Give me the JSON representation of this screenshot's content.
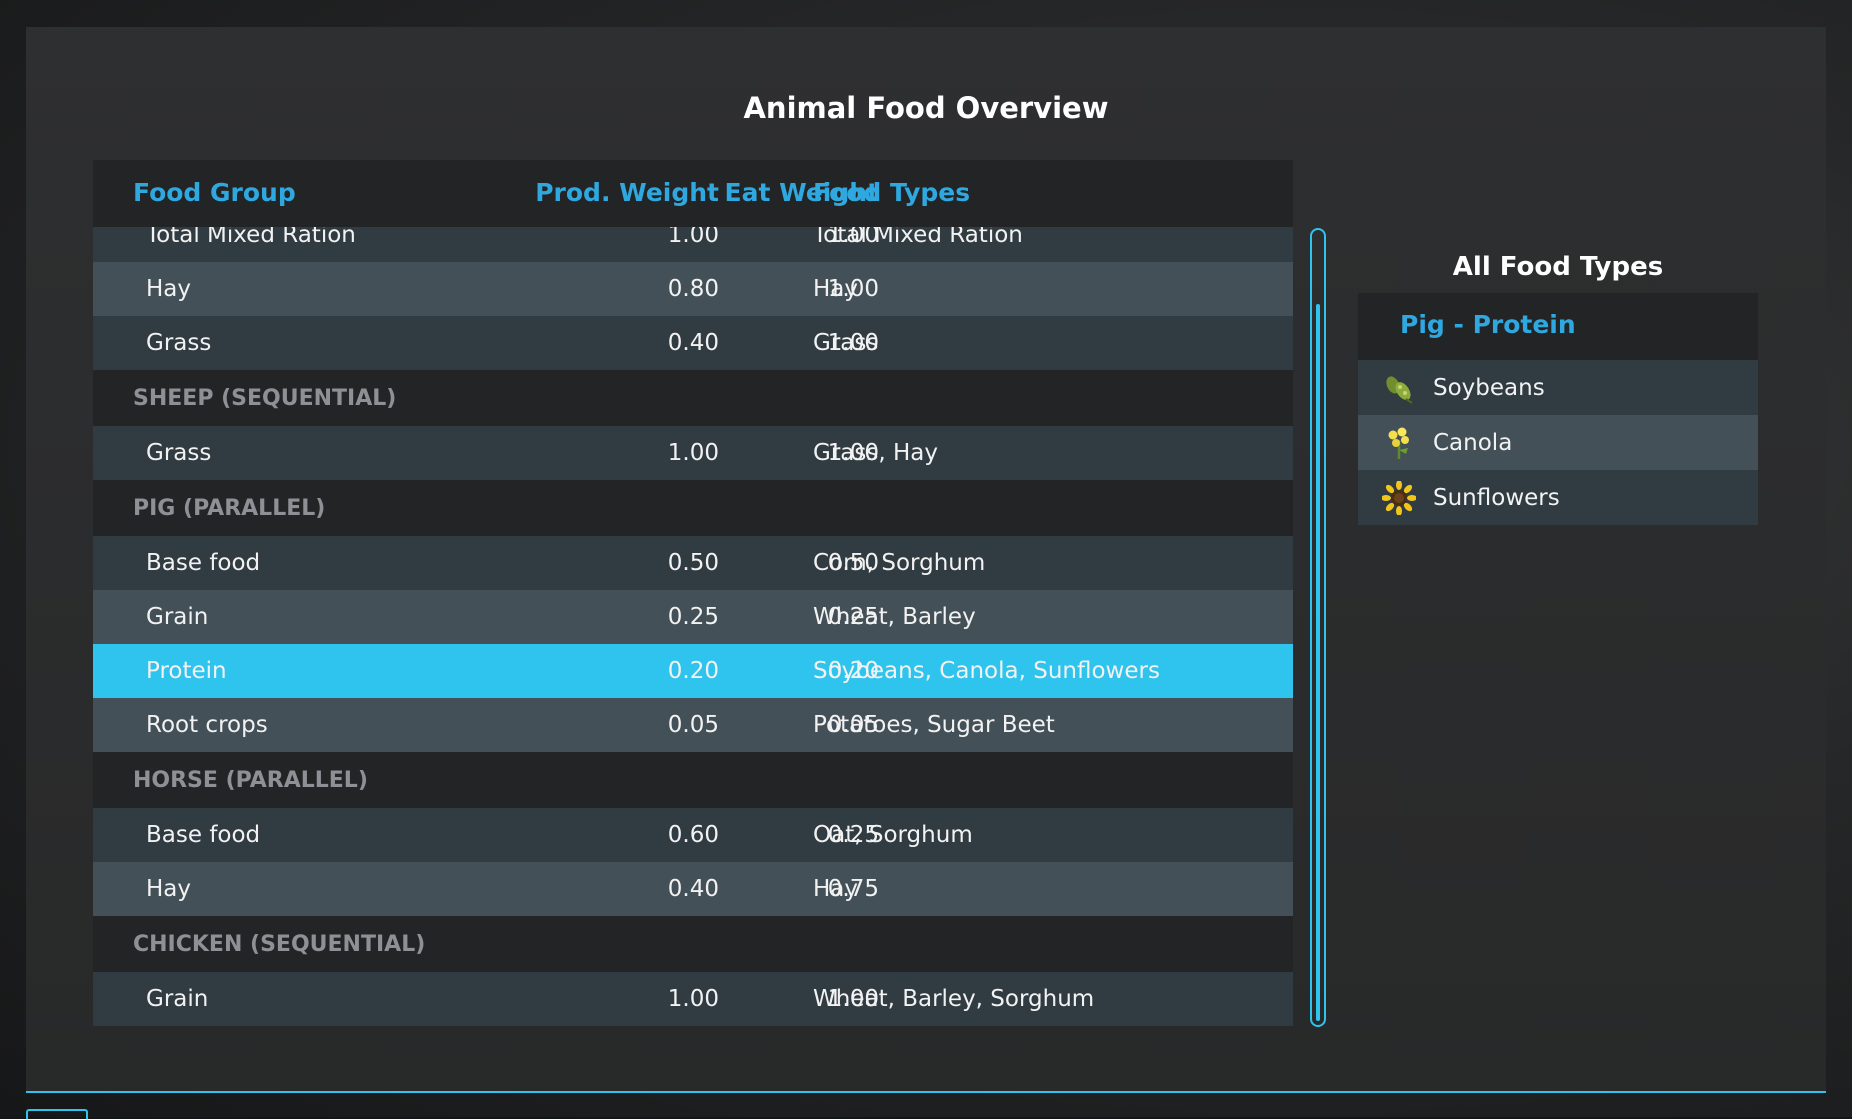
{
  "title": "Animal Food Overview",
  "table": {
    "headers": {
      "food_group": "Food Group",
      "prod_weight": "Prod. Weight",
      "eat_weight": "Eat Weight",
      "food_types": "Food Types"
    },
    "rows": [
      {
        "kind": "item",
        "name": "Total Mixed Ration",
        "prod": "1.00",
        "eat": "1.00",
        "types": "Total Mixed Ration"
      },
      {
        "kind": "item",
        "name": "Hay",
        "prod": "0.80",
        "eat": "1.00",
        "types": "Hay"
      },
      {
        "kind": "item",
        "name": "Grass",
        "prod": "0.40",
        "eat": "1.00",
        "types": "Grass"
      },
      {
        "kind": "section",
        "label": "SHEEP (SEQUENTIAL)"
      },
      {
        "kind": "item",
        "name": "Grass",
        "prod": "1.00",
        "eat": "1.00",
        "types": "Grass, Hay"
      },
      {
        "kind": "section",
        "label": "PIG (PARALLEL)"
      },
      {
        "kind": "item",
        "name": "Base food",
        "prod": "0.50",
        "eat": "0.50",
        "types": "Corn, Sorghum"
      },
      {
        "kind": "item",
        "name": "Grain",
        "prod": "0.25",
        "eat": "0.25",
        "types": "Wheat, Barley"
      },
      {
        "kind": "item",
        "name": "Protein",
        "prod": "0.20",
        "eat": "0.20",
        "types": "Soybeans, Canola, Sunflowers",
        "selected": true
      },
      {
        "kind": "item",
        "name": "Root crops",
        "prod": "0.05",
        "eat": "0.05",
        "types": "Potatoes, Sugar Beet"
      },
      {
        "kind": "section",
        "label": "HORSE (PARALLEL)"
      },
      {
        "kind": "item",
        "name": "Base food",
        "prod": "0.60",
        "eat": "0.25",
        "types": "Oat, Sorghum"
      },
      {
        "kind": "item",
        "name": "Hay",
        "prod": "0.40",
        "eat": "0.75",
        "types": "Hay"
      },
      {
        "kind": "section",
        "label": "CHICKEN (SEQUENTIAL)"
      },
      {
        "kind": "item",
        "name": "Grain",
        "prod": "1.00",
        "eat": "1.00",
        "types": "Wheat, Barley, Sorghum"
      }
    ]
  },
  "side_panel": {
    "title": "All Food Types",
    "header": "Pig - Protein",
    "items": [
      {
        "label": "Soybeans",
        "icon": "soybeans-icon"
      },
      {
        "label": "Canola",
        "icon": "canola-icon"
      },
      {
        "label": "Sunflowers",
        "icon": "sunflowers-icon"
      }
    ]
  },
  "colors": {
    "accent": "#2ec4ee",
    "header_text": "#2fa8e0",
    "row_dark": "#313b42",
    "row_light": "#435058",
    "section_bg": "#232425"
  }
}
